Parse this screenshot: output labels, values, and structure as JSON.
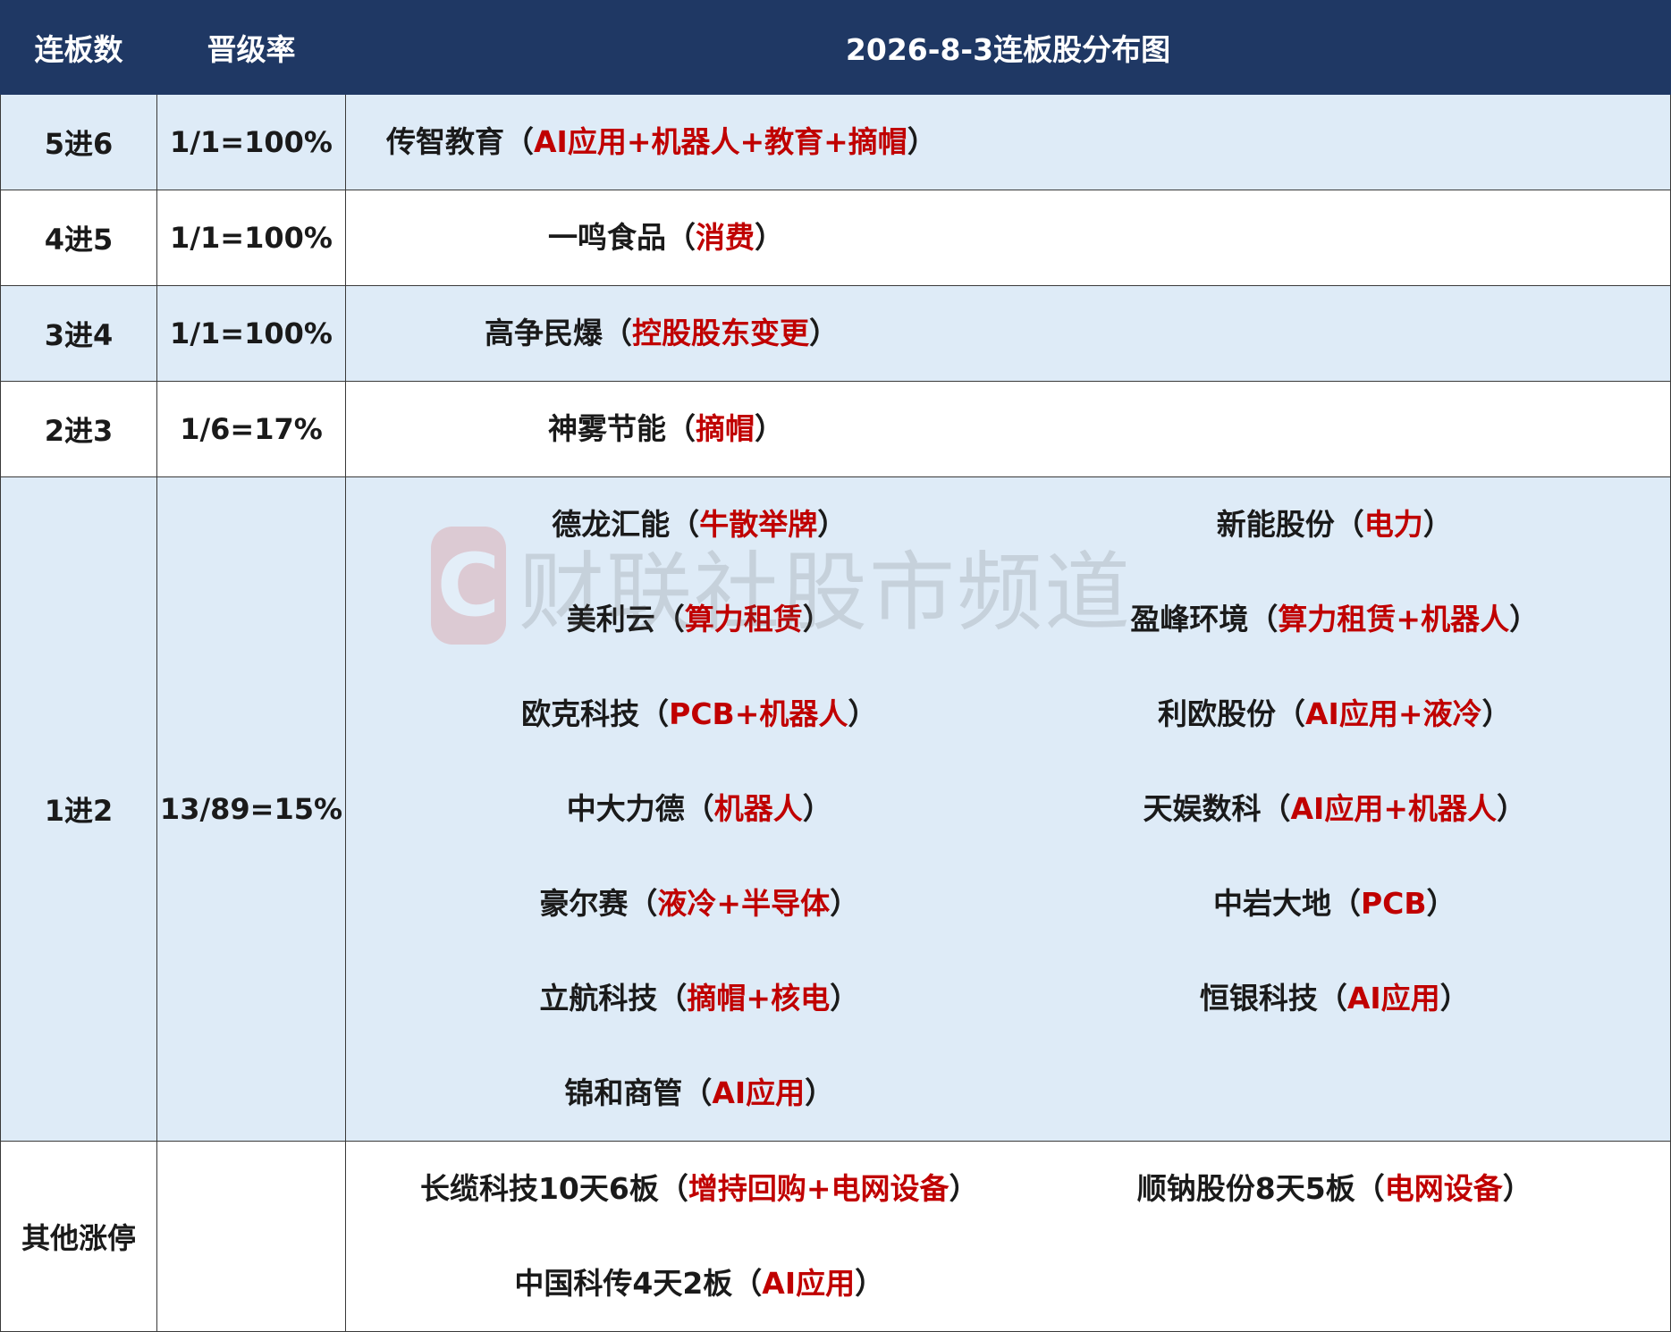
{
  "header": {
    "col1": "连板数",
    "col2": "晋级率",
    "col3": "2026-8-3连板股分布图"
  },
  "rows": [
    {
      "label": "5进6",
      "rate": "1/1=100%",
      "stocks": [
        {
          "name": "传智教育",
          "open": "（",
          "tag": "AI应用+机器人+教育+摘帽",
          "close": "）"
        }
      ]
    },
    {
      "label": "4进5",
      "rate": "1/1=100%",
      "stocks": [
        {
          "name": "一鸣食品",
          "open": "（",
          "tag": "消费",
          "close": "）"
        }
      ]
    },
    {
      "label": "3进4",
      "rate": "1/1=100%",
      "stocks": [
        {
          "name": "高争民爆",
          "open": "（",
          "tag": "控股股东变更",
          "close": "）"
        }
      ]
    },
    {
      "label": "2进3",
      "rate": "1/6=17%",
      "stocks": [
        {
          "name": "神雾节能",
          "open": "（",
          "tag": "摘帽",
          "close": "）"
        }
      ]
    },
    {
      "label": "1进2",
      "rate": "13/89=15%",
      "stocks": [
        {
          "name": "德龙汇能",
          "open": "（",
          "tag": "牛散举牌",
          "close": "）"
        },
        {
          "name": "新能股份",
          "open": "（",
          "tag": "电力",
          "close": "）"
        },
        {
          "name": "美利云",
          "open": "（",
          "tag": "算力租赁",
          "close": "）"
        },
        {
          "name": "盈峰环境",
          "open": "（",
          "tag": "算力租赁+机器人",
          "close": "）"
        },
        {
          "name": "欧克科技",
          "open": "（",
          "tag": "PCB+机器人",
          "close": "）"
        },
        {
          "name": "利欧股份",
          "open": "（",
          "tag": "AI应用+液冷",
          "close": "）"
        },
        {
          "name": "中大力德",
          "open": "（",
          "tag": "机器人",
          "close": "）"
        },
        {
          "name": "天娱数科",
          "open": "（",
          "tag": "AI应用+机器人",
          "close": "）"
        },
        {
          "name": "豪尔赛",
          "open": "（",
          "tag": "液冷+半导体",
          "close": "）"
        },
        {
          "name": "中岩大地",
          "open": "（",
          "tag": "PCB",
          "close": "）"
        },
        {
          "name": "立航科技",
          "open": "（",
          "tag": "摘帽+核电",
          "close": "）"
        },
        {
          "name": "恒银科技",
          "open": "（",
          "tag": "AI应用",
          "close": "）"
        },
        {
          "name": "锦和商管",
          "open": "（",
          "tag": "AI应用",
          "close": "）"
        }
      ]
    },
    {
      "label": "其他涨停",
      "rate": "",
      "stocks": [
        {
          "name": "长缆科技10天6板",
          "open": "（",
          "tag": "增持回购+电网设备",
          "close": "）"
        },
        {
          "name": "顺钠股份8天5板",
          "open": "（",
          "tag": "电网设备",
          "close": "）"
        },
        {
          "name": "中国科传4天2板",
          "open": "（",
          "tag": "AI应用",
          "close": "）"
        }
      ]
    }
  ],
  "watermark": {
    "logo": "C",
    "text": "财联社股市频道"
  },
  "colors": {
    "header_bg": "#1f3864",
    "band_bg": "#deebf7",
    "tag_red": "#c00000"
  }
}
